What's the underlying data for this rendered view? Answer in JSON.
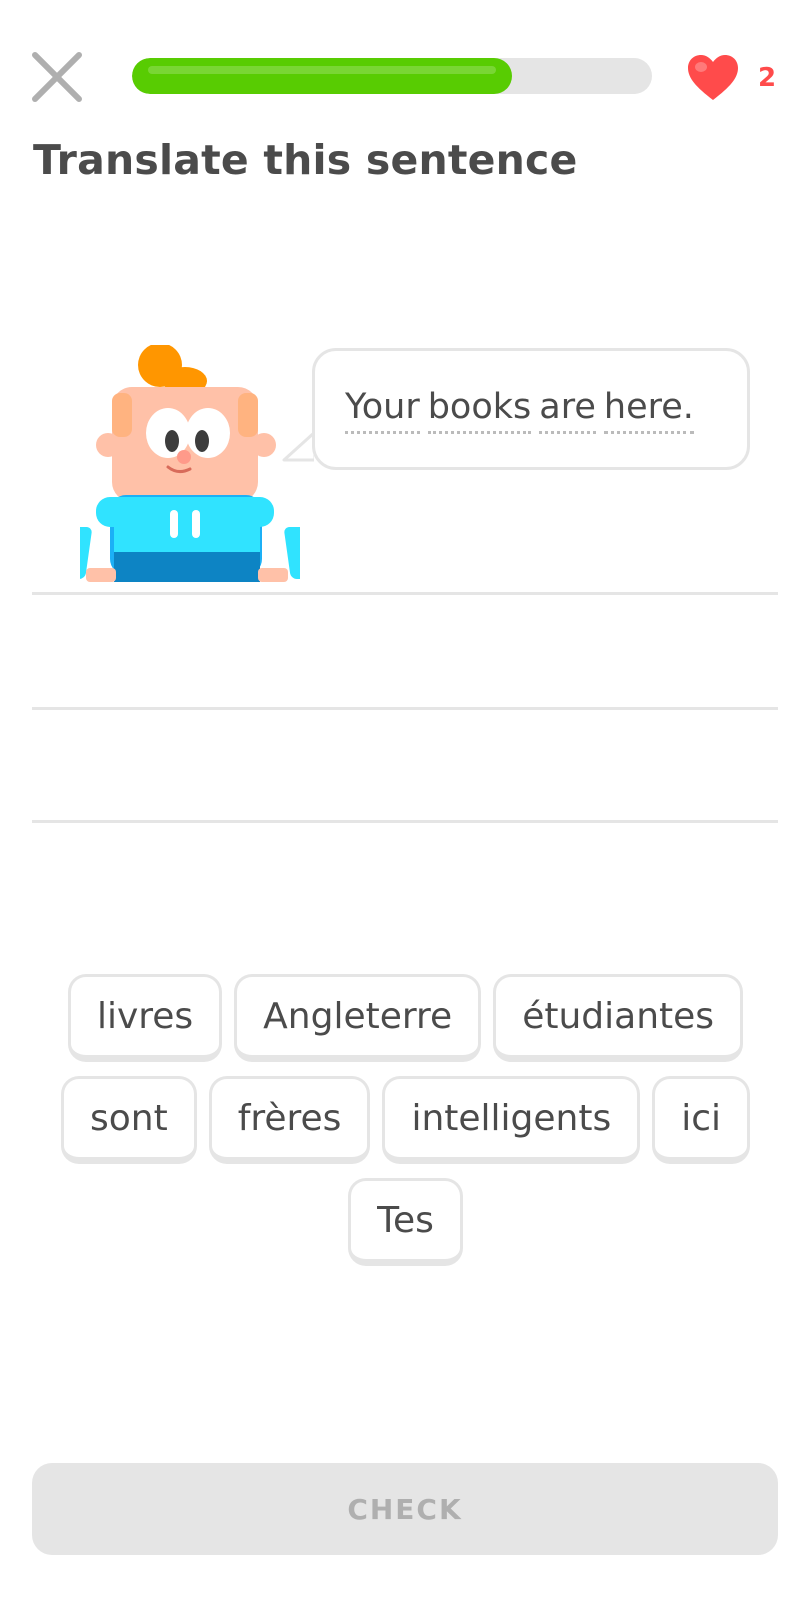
{
  "header": {
    "close_icon": "close-icon",
    "progress_fraction": 0.73,
    "progress_color": "#58cc02",
    "heart_icon": "heart-icon",
    "hearts_count": "2",
    "heart_color": "#ff4b4b"
  },
  "prompt": {
    "title": "Translate this sentence",
    "sentence_words": [
      "Your",
      "books",
      "are",
      "here."
    ]
  },
  "word_bank": {
    "rows": [
      [
        "livres",
        "Angleterre",
        "étudiantes"
      ],
      [
        "sont",
        "frères",
        "intelligents",
        "ici"
      ],
      [
        "Tes"
      ]
    ]
  },
  "footer": {
    "check_label": "CHECK"
  }
}
